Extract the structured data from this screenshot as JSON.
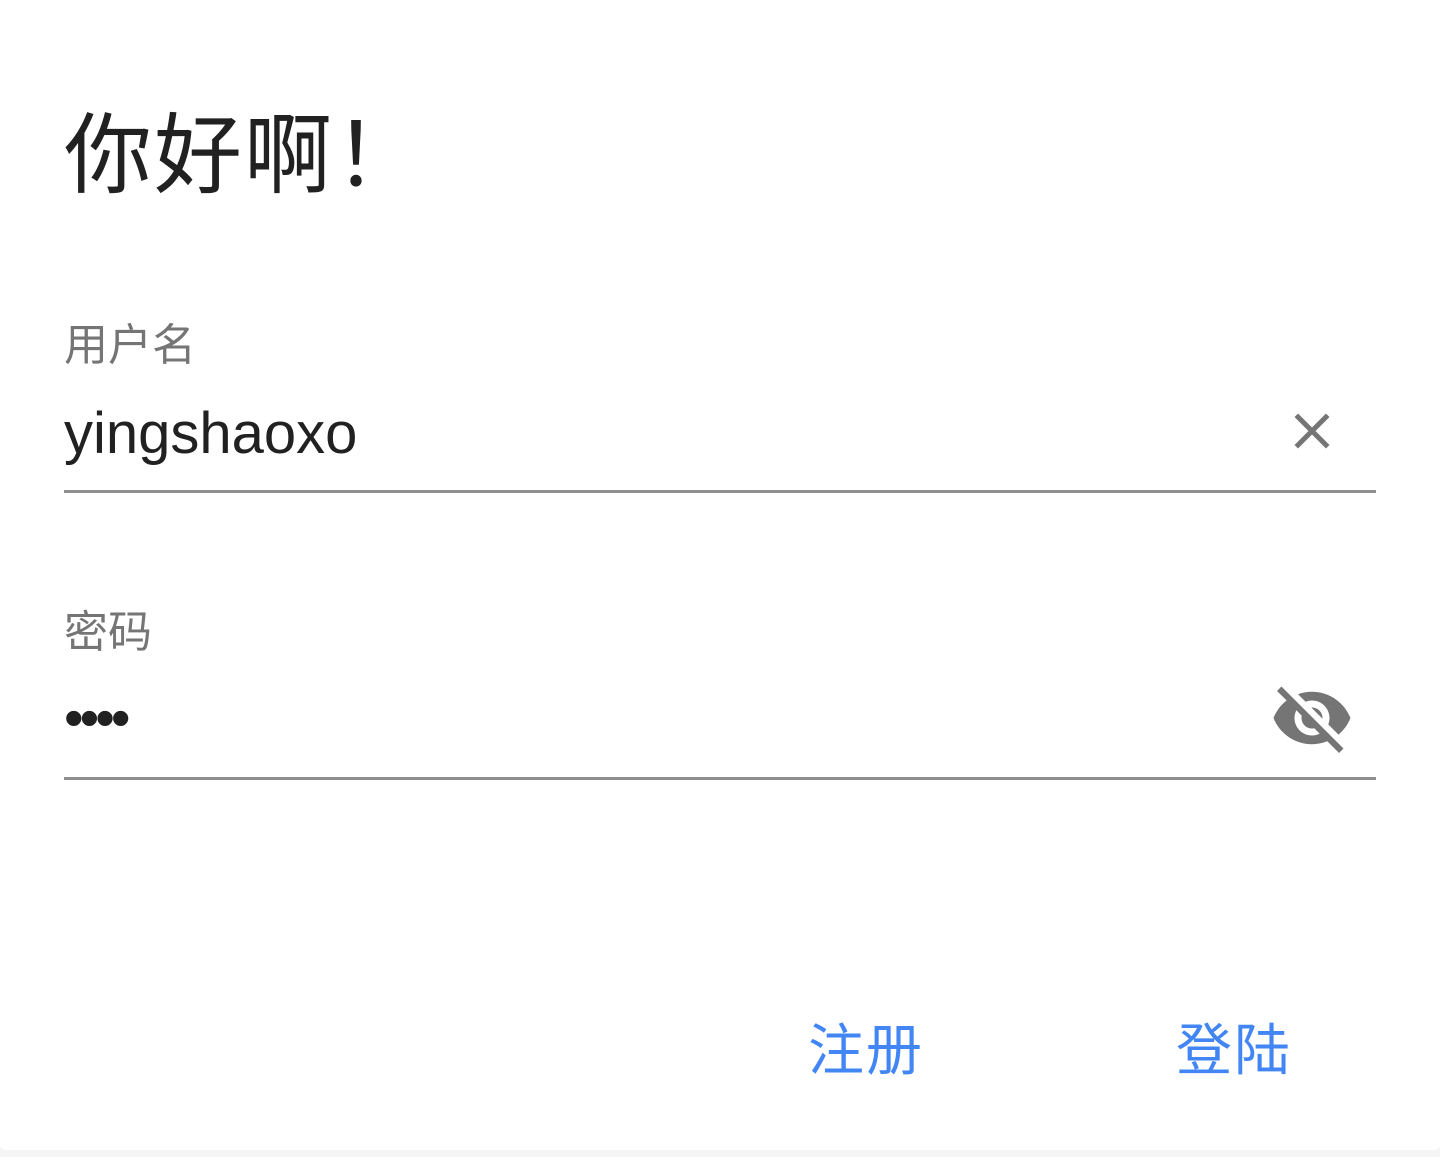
{
  "dialog": {
    "title": "你好啊！"
  },
  "username": {
    "label": "用户名",
    "value": "yingshaoxo",
    "clear_icon": "close-icon"
  },
  "password": {
    "label": "密码",
    "value": "••••",
    "visibility_icon": "visibility-off-icon"
  },
  "actions": {
    "register_label": "注册",
    "login_label": "登陆"
  },
  "colors": {
    "accent": "#4285f4",
    "text_primary": "#212121",
    "text_secondary": "#757575",
    "icon": "#757575",
    "underline": "#8e8e8e"
  }
}
